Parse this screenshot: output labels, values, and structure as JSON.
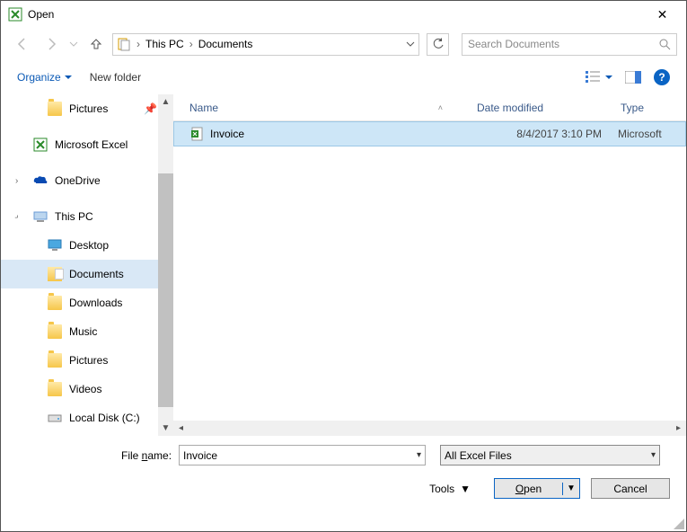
{
  "title": "Open",
  "address": {
    "root": "This PC",
    "folder": "Documents"
  },
  "search_placeholder": "Search Documents",
  "toolbar": {
    "organize": "Organize",
    "newfolder": "New folder"
  },
  "columns": {
    "name": "Name",
    "date": "Date modified",
    "type": "Type"
  },
  "nav": {
    "items": [
      {
        "label": "Pictures",
        "pinned": true
      },
      {
        "label": "Microsoft Excel"
      },
      {
        "label": "OneDrive"
      },
      {
        "label": "This PC",
        "expandable": true
      },
      {
        "label": "Desktop",
        "level": 2
      },
      {
        "label": "Documents",
        "level": 2,
        "selected": true
      },
      {
        "label": "Downloads",
        "level": 2
      },
      {
        "label": "Music",
        "level": 2
      },
      {
        "label": "Pictures",
        "level": 2
      },
      {
        "label": "Videos",
        "level": 2
      },
      {
        "label": "Local Disk (C:)",
        "level": 2
      }
    ]
  },
  "files": [
    {
      "name": "Invoice",
      "date": "8/4/2017 3:10 PM",
      "type": "Microsoft"
    }
  ],
  "filename_label_pre": "File ",
  "filename_label_u": "n",
  "filename_label_post": "ame:",
  "filename_value": "Invoice",
  "filter_value": "All Excel Files",
  "tools_label": "Too",
  "tools_u": "l",
  "tools_post": "s",
  "open_u": "O",
  "open_rest": "pen",
  "cancel": "Cancel"
}
